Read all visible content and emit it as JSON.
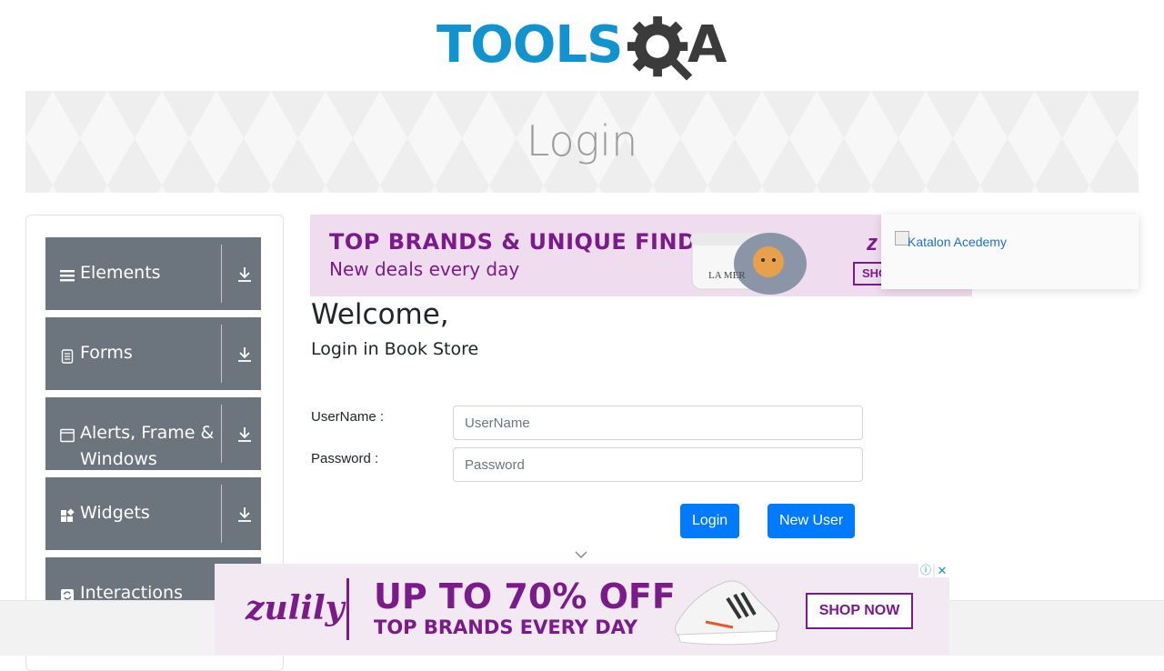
{
  "header": {
    "logo_tools": "TOOLS",
    "logo_a": "A"
  },
  "banner": {
    "title": "Login"
  },
  "sidebar": {
    "groups": [
      {
        "label": "Elements",
        "icon": "hamburger-icon"
      },
      {
        "label": "Forms",
        "icon": "document-icon"
      },
      {
        "label": "Alerts, Frame &",
        "label2": "Windows",
        "icon": "window-icon"
      },
      {
        "label": "Widgets",
        "icon": "grid-icon"
      },
      {
        "label": "Interactions",
        "icon": "refresh-icon"
      }
    ]
  },
  "ad_top": {
    "headline": "TOP BRANDS & UNIQUE FINDS",
    "subline": "New deals every day",
    "jar_label": "LA MER",
    "logo": "z",
    "shop_label": "SHO"
  },
  "katalon": {
    "alt_text": "Katalon Acedemy"
  },
  "main": {
    "welcome": "Welcome,",
    "subtitle": "Login in Book Store",
    "username_label": "UserName :",
    "username_placeholder": "UserName",
    "password_label": "Password :",
    "password_placeholder": "Password",
    "login_button": "Login",
    "new_user_button": "New User"
  },
  "ad_bottom": {
    "brand": "zulily",
    "headline": "UP TO 70% OFF",
    "subline": "TOP BRANDS EVERY DAY",
    "shop_label": "SHOP NOW",
    "adchoices_icon": "info-icon",
    "close_icon": "close-icon",
    "close_glyph": "✕",
    "info_glyph": "ⓘ"
  },
  "colors": {
    "primary_button": "#007bff",
    "sidebar_group": "#6c757d",
    "logo_blue": "#1193d0",
    "ad_purple": "#7b1a8a"
  }
}
